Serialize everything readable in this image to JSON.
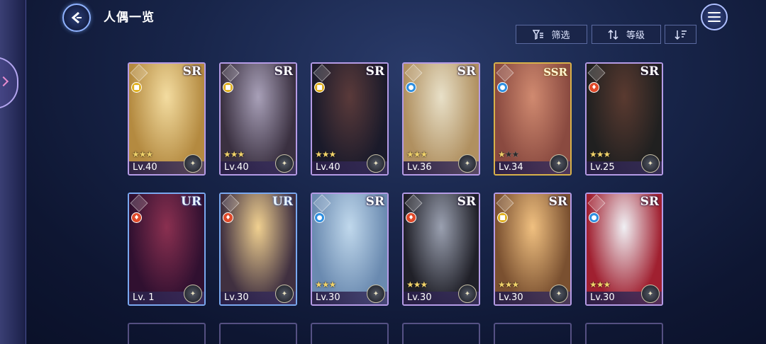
{
  "header": {
    "title": "人偶一览",
    "filter_label": "筛选",
    "level_sort_label": "等级"
  },
  "cards": [
    {
      "rarity": "SR",
      "element": "light",
      "stars": 3,
      "max_stars": 3,
      "level": "Lv.40",
      "art": [
        "#f3dca0",
        "#b48a40"
      ]
    },
    {
      "rarity": "SR",
      "element": "light",
      "stars": 3,
      "max_stars": 3,
      "level": "Lv.40",
      "art": [
        "#a8a0b8",
        "#3a3040"
      ]
    },
    {
      "rarity": "SR",
      "element": "light",
      "stars": 3,
      "max_stars": 3,
      "level": "Lv.40",
      "art": [
        "#5a3a3a",
        "#1a1a2a"
      ]
    },
    {
      "rarity": "SR",
      "element": "water",
      "stars": 3,
      "max_stars": 3,
      "level": "Lv.36",
      "art": [
        "#e8e0c8",
        "#b09060"
      ]
    },
    {
      "rarity": "SSR",
      "element": "water",
      "stars": 1,
      "max_stars": 3,
      "level": "Lv.34",
      "art": [
        "#d08a70",
        "#8a4a40"
      ]
    },
    {
      "rarity": "SR",
      "element": "fire",
      "stars": 3,
      "max_stars": 3,
      "level": "Lv.25",
      "art": [
        "#5a3a30",
        "#202020"
      ]
    },
    {
      "rarity": "UR",
      "element": "fire",
      "stars": 0,
      "max_stars": 3,
      "level": "Lv. 1",
      "art": [
        "#8a3050",
        "#301030"
      ]
    },
    {
      "rarity": "UR",
      "element": "fire",
      "stars": 0,
      "max_stars": 3,
      "level": "Lv.30",
      "art": [
        "#f0d090",
        "#403040"
      ]
    },
    {
      "rarity": "SR",
      "element": "water",
      "stars": 3,
      "max_stars": 3,
      "level": "Lv.30",
      "art": [
        "#c0d8ec",
        "#6a8ab0"
      ]
    },
    {
      "rarity": "SR",
      "element": "fire",
      "stars": 3,
      "max_stars": 3,
      "level": "Lv.30",
      "art": [
        "#9aa0b0",
        "#202028"
      ]
    },
    {
      "rarity": "SR",
      "element": "light",
      "stars": 3,
      "max_stars": 3,
      "level": "Lv.30",
      "art": [
        "#f0c080",
        "#7a5030"
      ]
    },
    {
      "rarity": "SR",
      "element": "water",
      "stars": 3,
      "max_stars": 3,
      "level": "Lv.30",
      "art": [
        "#f0f0f4",
        "#a02030"
      ]
    }
  ],
  "colors": {
    "sr_border": "#b59be6",
    "ssr_border": "#d8b24a",
    "ur_border": "#7aa8f0"
  }
}
